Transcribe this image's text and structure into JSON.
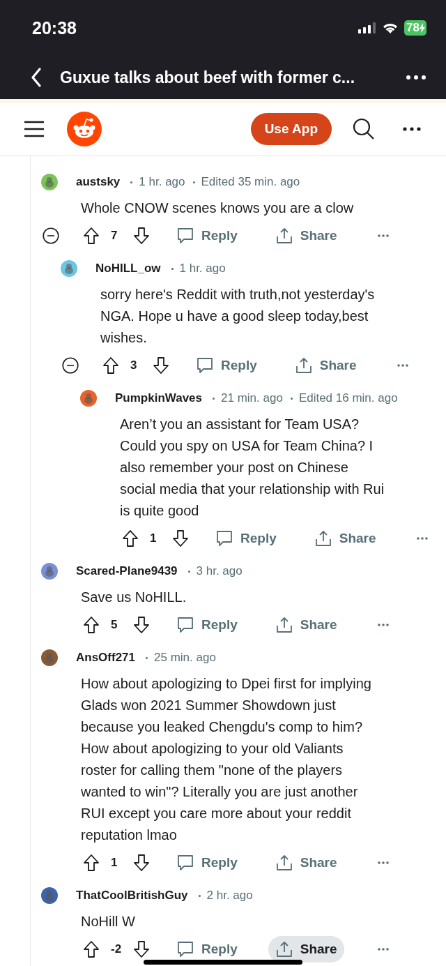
{
  "status_bar": {
    "time": "20:38",
    "battery": "78"
  },
  "nav": {
    "title": "Guxue talks about beef with former c..."
  },
  "header": {
    "use_app": "Use App"
  },
  "comments": [
    {
      "user": "austsky",
      "meta": [
        "1 hr. ago",
        "Edited 35 min. ago"
      ],
      "color": "#7cc35a",
      "body": [
        "Whole CNOW scenes knows you are a clow"
      ],
      "votes": "7",
      "reply": "Reply",
      "share": "Share",
      "share_pressed": false,
      "children": [
        {
          "user": "NoHILL_ow",
          "meta": [
            "1 hr. ago"
          ],
          "color": "#6cc6e0",
          "body": [
            "sorry here's Reddit with truth,not yesterday's",
            "NGA. Hope u have a good sleep today,best",
            "wishes."
          ],
          "votes": "3",
          "reply": "Reply",
          "share": "Share",
          "share_pressed": false,
          "children": [
            {
              "user": "PumpkinWaves",
              "meta": [
                "21 min. ago",
                "Edited 16 min. ago"
              ],
              "color": "#e8642c",
              "body": [
                "Aren’t you an assistant for Team USA?",
                "Could you spy on USA for Team China? I",
                "also remember your post on Chinese",
                "social media that your relationship with Rui",
                "is quite good"
              ],
              "votes": "1",
              "reply": "Reply",
              "share": "Share",
              "share_pressed": false
            }
          ]
        }
      ]
    },
    {
      "user": "Scared-Plane9439",
      "meta": [
        "3 hr. ago"
      ],
      "color": "#7b8fd6",
      "body": [
        "Save us NoHILL."
      ],
      "votes": "5",
      "reply": "Reply",
      "share": "Share",
      "share_pressed": false
    },
    {
      "user": "AnsOff271",
      "meta": [
        "25 min. ago"
      ],
      "color": "#8a5a36",
      "body": [
        "How about apologizing to Dpei first for implying",
        "Glads won 2021 Summer Showdown just",
        "because you leaked Chengdu's comp to him?",
        "How about apologizing to your old Valiants",
        "roster for calling them \"none of the players",
        "wanted to win\"? Literally you are just another",
        "RUI except you care more about your reddit",
        "reputation lmao"
      ],
      "votes": "1",
      "reply": "Reply",
      "share": "Share",
      "share_pressed": false
    },
    {
      "user": "ThatCoolBritishGuy",
      "meta": [
        "2 hr. ago"
      ],
      "color": "#3f63a8",
      "body": [
        "NoHill W"
      ],
      "votes": "-2",
      "reply": "Reply",
      "share": "Share",
      "share_pressed": true
    }
  ]
}
